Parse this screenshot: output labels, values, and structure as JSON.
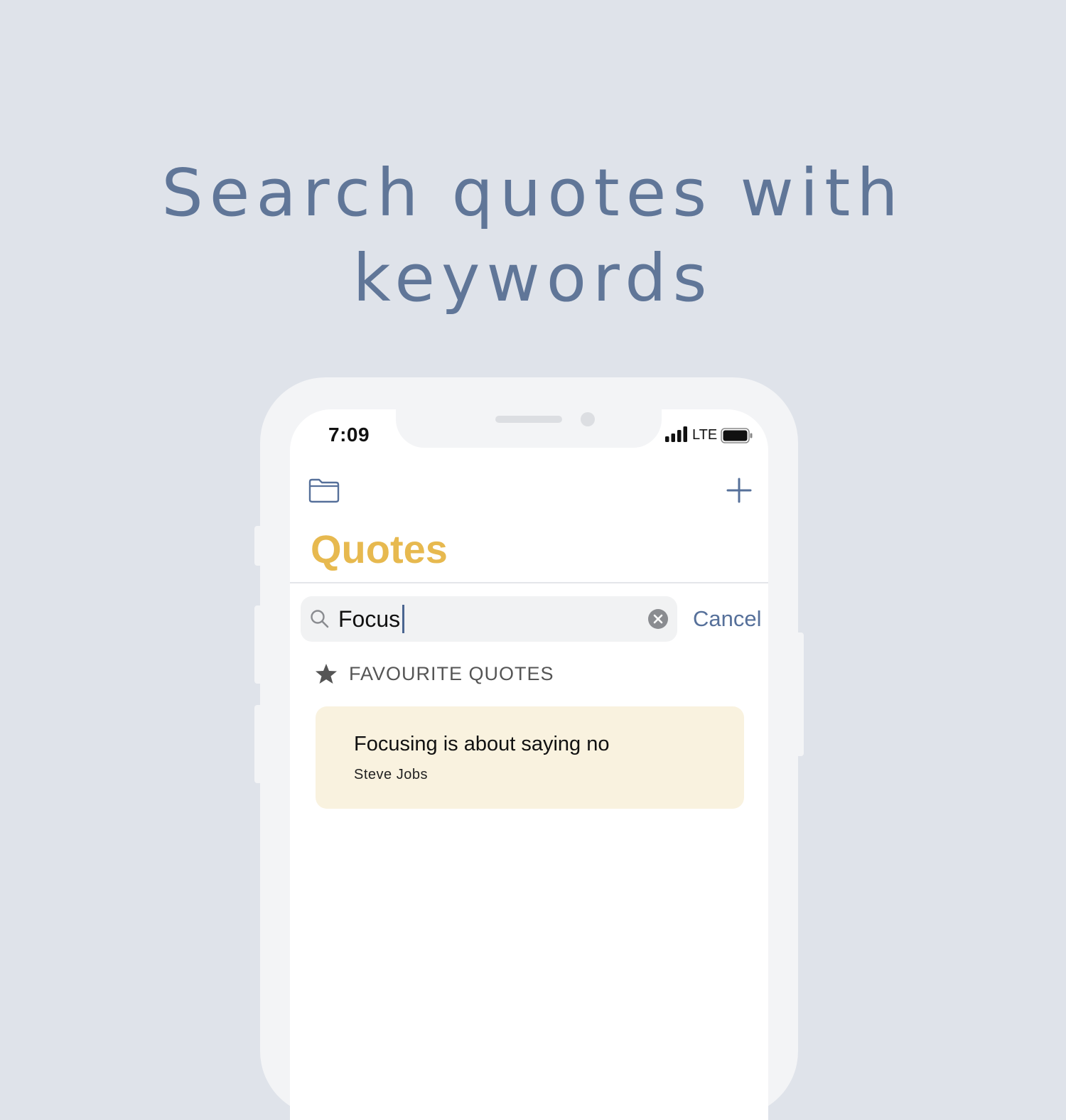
{
  "headline": {
    "line1": "Search quotes with",
    "line2": "keywords"
  },
  "status_bar": {
    "time": "7:09",
    "network": "LTE",
    "icons": [
      "signal-bars-icon",
      "battery-icon"
    ]
  },
  "nav": {
    "left_icon": "folder-icon",
    "right_icon": "plus-icon"
  },
  "page": {
    "title": "Quotes"
  },
  "search": {
    "value": "Focus",
    "cancel_label": "Cancel",
    "icons": [
      "search-icon",
      "clear-icon"
    ]
  },
  "section": {
    "icon": "star-icon",
    "label": "FAVOURITE QUOTES"
  },
  "results": [
    {
      "text": "Focusing is about saying no",
      "author": "Steve Jobs"
    }
  ],
  "colors": {
    "background": "#dfe3ea",
    "headline": "#607698",
    "title_accent": "#e7b94f",
    "link": "#56709a",
    "card": "#f9f2df"
  }
}
